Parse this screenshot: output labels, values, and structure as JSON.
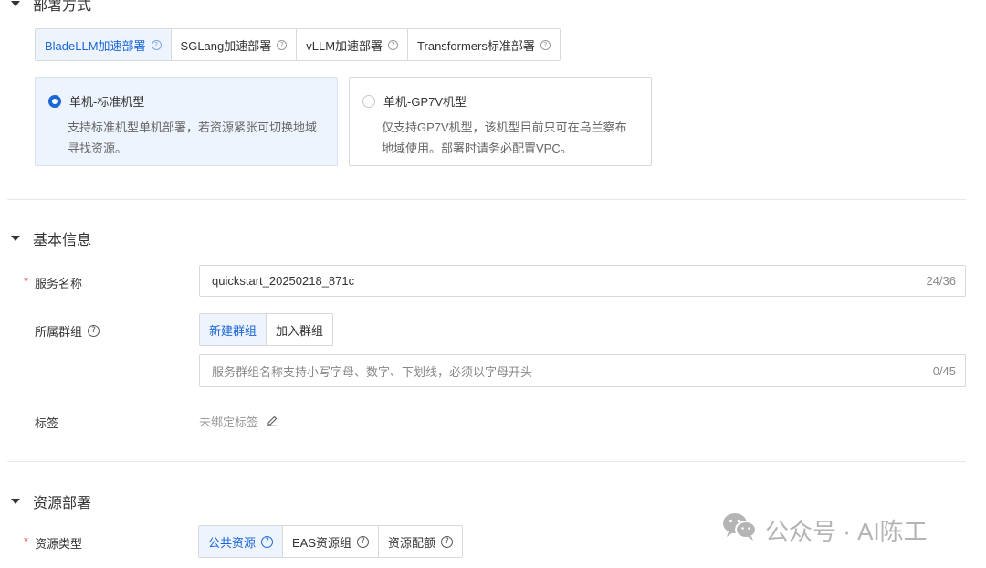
{
  "deploy_section": {
    "title": "部署方式",
    "tabs": [
      {
        "label": "BladeLLM加速部署",
        "active": true
      },
      {
        "label": "SGLang加速部署",
        "active": false
      },
      {
        "label": "vLLM加速部署",
        "active": false
      },
      {
        "label": "Transformers标准部署",
        "active": false
      }
    ],
    "cards": [
      {
        "title": "单机-标准机型",
        "desc": "支持标准机型单机部署，若资源紧张可切换地域\n寻找资源。",
        "selected": true
      },
      {
        "title": "单机-GP7V机型",
        "desc": "仅支持GP7V机型，该机型目前只可在乌兰察布\n地域使用。部署时请务必配置VPC。",
        "selected": false
      }
    ]
  },
  "basic_section": {
    "title": "基本信息",
    "service_name": {
      "label": "服务名称",
      "value": "quickstart_20250218_871c",
      "count": "24/36"
    },
    "group": {
      "label": "所属群组",
      "tabs": [
        {
          "label": "新建群组",
          "active": true
        },
        {
          "label": "加入群组",
          "active": false
        }
      ],
      "placeholder": "服务群组名称支持小写字母、数字、下划线，必须以字母开头",
      "count": "0/45"
    },
    "tags": {
      "label": "标签",
      "empty_text": "未绑定标签"
    }
  },
  "resource_section": {
    "title": "资源部署",
    "resource_type": {
      "label": "资源类型",
      "tabs": [
        {
          "label": "公共资源",
          "active": true
        },
        {
          "label": "EAS资源组",
          "active": false
        },
        {
          "label": "资源配额",
          "active": false
        }
      ]
    }
  },
  "watermark": {
    "text": "公众号 · AI陈工"
  },
  "colors": {
    "accent": "#1b66d8",
    "selected_bg": "#eef4fd",
    "required": "#e0443a"
  }
}
